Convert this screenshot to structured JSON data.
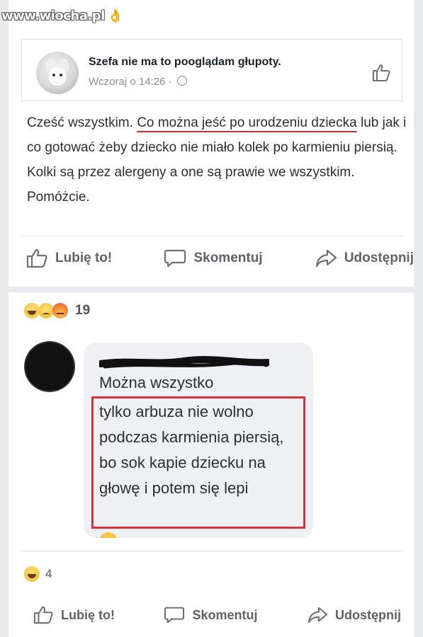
{
  "watermark": {
    "text": "www.wiocha.pl"
  },
  "post": {
    "group_name": "Szefa nie ma to pooglądam głupoty.",
    "time": "Wczoraj o 14:26",
    "separator": "·",
    "text_parts": [
      "Cześć wszystkim. ",
      "Co można jeść po urodzeniu dziecka",
      " lub jak i co gotować żeby dziecko nie miało kolek po karmieniu piersią. Kolki są przez alergeny a one są prawie we wszystkim. Pomóżcie."
    ]
  },
  "actions": {
    "like": "Lubię to!",
    "comment": "Skomentuj",
    "share": "Udostępnij"
  },
  "reactions": {
    "count": "19",
    "types": [
      "haha",
      "sad",
      "angry"
    ]
  },
  "comment": {
    "line1": "Można wszystko",
    "highlighted": "tylko arbuza nie wolno podczas karmienia piersią, bo sok kapie dziecku na głowę i potem się lepi"
  },
  "comment_reactions": {
    "count": "4",
    "type": "haha"
  },
  "colors": {
    "highlight": "#d6323a",
    "text": "#2b2e33",
    "muted": "#5f6368"
  },
  "icons": [
    "like-icon",
    "comment-icon",
    "share-icon",
    "globe-icon"
  ]
}
